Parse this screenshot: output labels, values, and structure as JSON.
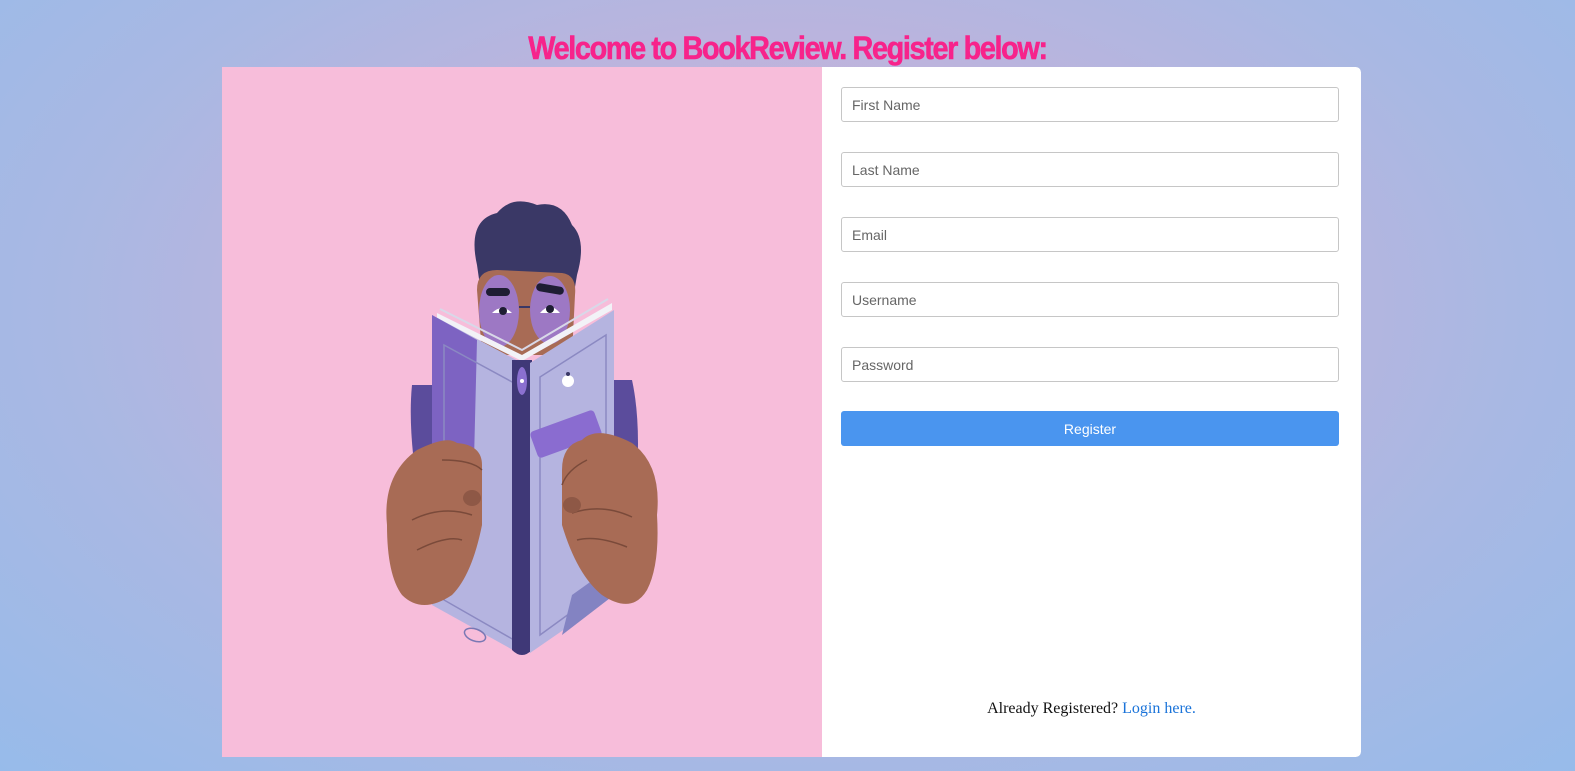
{
  "header": {
    "title": "Welcome to BookReview. Register below:"
  },
  "illustration": {
    "subject": "person-reading-book",
    "background_color": "#f7bdda"
  },
  "form": {
    "fields": [
      {
        "name": "first-name",
        "placeholder": "First Name",
        "value": ""
      },
      {
        "name": "last-name",
        "placeholder": "Last Name",
        "value": ""
      },
      {
        "name": "email",
        "placeholder": "Email",
        "value": ""
      },
      {
        "name": "username",
        "placeholder": "Username",
        "value": ""
      },
      {
        "name": "password",
        "placeholder": "Password",
        "value": ""
      }
    ],
    "submit_label": "Register"
  },
  "footer": {
    "prompt_text": "Already Registered?",
    "link_text": "Login here."
  },
  "colors": {
    "title": "#f7238b",
    "button": "#4a95ef",
    "link": "#1a73d9"
  }
}
